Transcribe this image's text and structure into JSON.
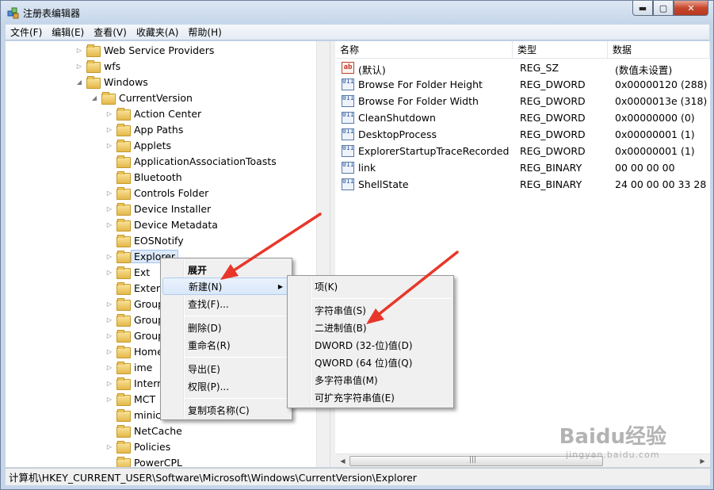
{
  "window": {
    "title": "注册表编辑器"
  },
  "menubar": {
    "items": [
      "文件(F)",
      "编辑(E)",
      "查看(V)",
      "收藏夹(A)",
      "帮助(H)"
    ]
  },
  "tree": {
    "items": [
      {
        "label": "Web Service Providers",
        "expander": "▷"
      },
      {
        "label": "wfs",
        "expander": "▷"
      },
      {
        "label": "Windows",
        "expander": "◢"
      },
      {
        "label": "CurrentVersion",
        "expander": "◢"
      },
      {
        "label": "Action Center",
        "expander": "▷"
      },
      {
        "label": "App Paths",
        "expander": "▷"
      },
      {
        "label": "Applets",
        "expander": "▷"
      },
      {
        "label": "ApplicationAssociationToasts",
        "expander": ""
      },
      {
        "label": "Bluetooth",
        "expander": ""
      },
      {
        "label": "Controls Folder",
        "expander": "▷"
      },
      {
        "label": "Device Installer",
        "expander": "▷"
      },
      {
        "label": "Device Metadata",
        "expander": "▷"
      },
      {
        "label": "EOSNotify",
        "expander": ""
      },
      {
        "label": "Explorer",
        "expander": "▷"
      },
      {
        "label": "Ext",
        "expander": "▷"
      },
      {
        "label": "Extens",
        "expander": ""
      },
      {
        "label": "Group",
        "expander": "▷"
      },
      {
        "label": "Group",
        "expander": "▷"
      },
      {
        "label": "Group",
        "expander": "▷"
      },
      {
        "label": "Home",
        "expander": "▷"
      },
      {
        "label": "ime",
        "expander": "▷"
      },
      {
        "label": "Intern",
        "expander": "▷"
      },
      {
        "label": "MCT",
        "expander": "▷"
      },
      {
        "label": "minico",
        "expander": ""
      },
      {
        "label": "NetCache",
        "expander": ""
      },
      {
        "label": "Policies",
        "expander": "▷"
      },
      {
        "label": "PowerCPL",
        "expander": ""
      }
    ]
  },
  "values": {
    "headers": {
      "name": "名称",
      "type": "类型",
      "data": "数据"
    },
    "rows": [
      {
        "icon": "string-value-icon",
        "icon_text": "ab",
        "name": "(默认)",
        "type": "REG_SZ",
        "data": "(数值未设置)"
      },
      {
        "icon": "binary-value-icon",
        "icon_text": "011 110",
        "name": "Browse For Folder Height",
        "type": "REG_DWORD",
        "data": "0x00000120 (288)"
      },
      {
        "icon": "binary-value-icon",
        "icon_text": "011 110",
        "name": "Browse For Folder Width",
        "type": "REG_DWORD",
        "data": "0x0000013e (318)"
      },
      {
        "icon": "binary-value-icon",
        "icon_text": "011 110",
        "name": "CleanShutdown",
        "type": "REG_DWORD",
        "data": "0x00000000 (0)"
      },
      {
        "icon": "binary-value-icon",
        "icon_text": "011 110",
        "name": "DesktopProcess",
        "type": "REG_DWORD",
        "data": "0x00000001 (1)"
      },
      {
        "icon": "binary-value-icon",
        "icon_text": "011 110",
        "name": "ExplorerStartupTraceRecorded",
        "type": "REG_DWORD",
        "data": "0x00000001 (1)"
      },
      {
        "icon": "binary-value-icon",
        "icon_text": "011 110",
        "name": "link",
        "type": "REG_BINARY",
        "data": "00 00 00 00"
      },
      {
        "icon": "binary-value-icon",
        "icon_text": "011 110",
        "name": "ShellState",
        "type": "REG_BINARY",
        "data": "24 00 00 00 33 28 00"
      }
    ]
  },
  "context_menu": {
    "items": [
      {
        "label": "展开",
        "bold": true
      },
      {
        "label": "新建(N)",
        "submenu": "▶"
      },
      {
        "label": "查找(F)..."
      },
      {
        "label": "删除(D)"
      },
      {
        "label": "重命名(R)"
      },
      {
        "label": "导出(E)"
      },
      {
        "label": "权限(P)..."
      },
      {
        "label": "复制项名称(C)"
      }
    ]
  },
  "new_submenu": {
    "items": [
      {
        "label": "项(K)"
      },
      {
        "label": "字符串值(S)"
      },
      {
        "label": "二进制值(B)"
      },
      {
        "label": "DWORD (32-位)值(D)"
      },
      {
        "label": "QWORD (64 位)值(Q)"
      },
      {
        "label": "多字符串值(M)"
      },
      {
        "label": "可扩充字符串值(E)"
      }
    ]
  },
  "statusbar": {
    "path": "计算机\\HKEY_CURRENT_USER\\Software\\Microsoft\\Windows\\CurrentVersion\\Explorer"
  },
  "scrollbar": {
    "thumb_glyph": "|||"
  },
  "watermark": {
    "logo": "Baidu经验",
    "url": "jingyan.baidu.com"
  },
  "colors": {
    "selection_bg": "#dceafb",
    "annotation_red": "#e8372a",
    "menu_bg": "#f0f0f0",
    "folder": "#e5b84a"
  }
}
